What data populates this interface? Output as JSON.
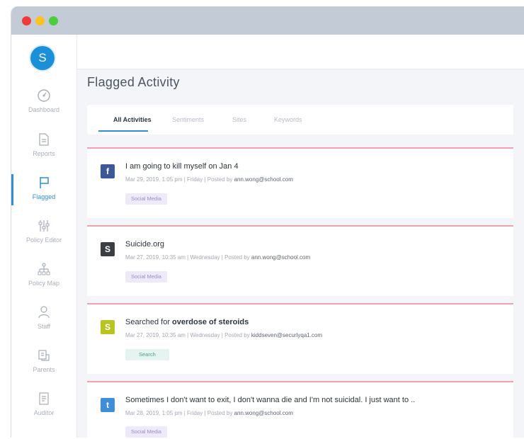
{
  "sidebar": {
    "avatar_letter": "S",
    "items": [
      {
        "label": "Dashboard",
        "icon": "dashboard-icon"
      },
      {
        "label": "Reports",
        "icon": "reports-icon"
      },
      {
        "label": "Flagged",
        "icon": "flag-icon"
      },
      {
        "label": "Policy Editor",
        "icon": "sliders-icon"
      },
      {
        "label": "Policy Map",
        "icon": "map-icon"
      },
      {
        "label": "Staff",
        "icon": "staff-icon"
      },
      {
        "label": "Parents",
        "icon": "parents-icon"
      },
      {
        "label": "Auditor",
        "icon": "auditor-icon"
      }
    ]
  },
  "page": {
    "title": "Flagged Activity"
  },
  "tabs": [
    "All Activities",
    "Sentiments",
    "Sites",
    "Keywords"
  ],
  "activities": [
    {
      "source": "facebook",
      "icon_color": "#3b5998",
      "icon_glyph": "f",
      "message": "I am going to kill myself on Jan 4",
      "meta_prefix": "Mar 29, 2019, 1:05 pm | Friday | Posted by ",
      "posted_by": "ann.wong@school.com",
      "badge": "Social Media"
    },
    {
      "source": "site",
      "icon_color": "#3a3d42",
      "icon_glyph": "S",
      "message": "Suicide.org",
      "meta_prefix": "Mar 27, 2019, 10:35 am | Wednesday | Posted by ",
      "posted_by": "ann.wong@school.com",
      "badge": "Social Media"
    },
    {
      "source": "search",
      "icon_color": "#b9c421",
      "icon_glyph": "S",
      "message_prefix": "Searched for ",
      "message_bold": "overdose of steroids",
      "meta_prefix": "Mar 27, 2019, 10:35 am | Wednesday | Posted by ",
      "posted_by": "kiddseven@securlyqa1.com",
      "badge": "Search"
    },
    {
      "source": "twitter",
      "icon_color": "#3f8ed8",
      "icon_glyph": "t",
      "message": "Sometimes I don't want to exit, I don't wanna die and I'm not suicidal. I just want to ..",
      "meta_prefix": "Mar 28, 2019, 1:05 pm | Friday | Posted by ",
      "posted_by": "ann.wong@school.com",
      "badge": "Social Media"
    }
  ]
}
